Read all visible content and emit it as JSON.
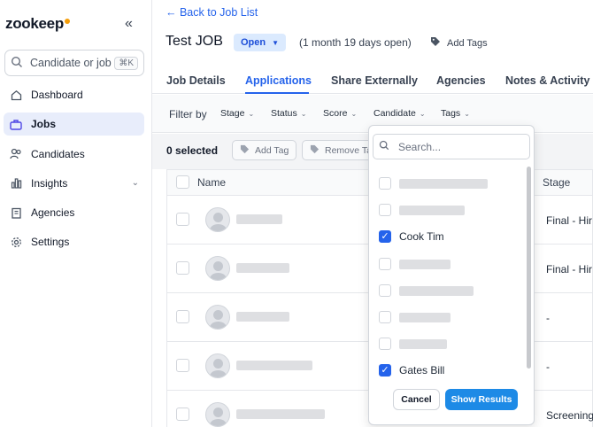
{
  "app": {
    "logo_text": "zookeep",
    "accent_color": "#2563eb",
    "brand_dot_color": "#f59e0b"
  },
  "sidebar": {
    "search_placeholder": "Candidate or job",
    "search_shortcut": "⌘K",
    "items": [
      {
        "label": "Dashboard",
        "icon": "home-icon",
        "active": false
      },
      {
        "label": "Jobs",
        "icon": "briefcase-icon",
        "active": true
      },
      {
        "label": "Candidates",
        "icon": "users-icon",
        "active": false
      },
      {
        "label": "Insights",
        "icon": "bar-chart-icon",
        "active": false,
        "has_chevron": true
      },
      {
        "label": "Agencies",
        "icon": "building-icon",
        "active": false
      },
      {
        "label": "Settings",
        "icon": "gear-icon",
        "active": false
      }
    ]
  },
  "header": {
    "back_label": "← Back to Job List",
    "job_title": "Test JOB",
    "status": "Open",
    "duration": "(1 month 19 days open)",
    "add_tags_label": "Add Tags"
  },
  "tabs": [
    {
      "label": "Job Details",
      "active": false
    },
    {
      "label": "Applications",
      "active": true
    },
    {
      "label": "Share Externally",
      "active": false
    },
    {
      "label": "Agencies",
      "active": false
    },
    {
      "label": "Notes & Activity",
      "active": false
    }
  ],
  "filters": {
    "label": "Filter by",
    "chips": [
      "Stage",
      "Status",
      "Score",
      "Candidate",
      "Tags"
    ]
  },
  "bulk": {
    "selected_text": "0 selected",
    "add_tag_label": "Add Tag",
    "remove_tag_label": "Remove Ta"
  },
  "table": {
    "columns": [
      "Name",
      "Stage"
    ],
    "rows": [
      {
        "stage": "Final - Hir"
      },
      {
        "stage": "Final - Hir"
      },
      {
        "stage": "-"
      },
      {
        "stage": "-"
      },
      {
        "stage": "Screening"
      }
    ]
  },
  "candidate_dropdown": {
    "search_placeholder": "Search...",
    "options": [
      {
        "name": "",
        "checked": false,
        "redacted": true
      },
      {
        "name": "",
        "checked": false,
        "redacted": true
      },
      {
        "name": "Cook Tim",
        "checked": true,
        "redacted": false
      },
      {
        "name": "",
        "checked": false,
        "redacted": true
      },
      {
        "name": "",
        "checked": false,
        "redacted": true
      },
      {
        "name": "",
        "checked": false,
        "redacted": true
      },
      {
        "name": "",
        "checked": false,
        "redacted": true
      },
      {
        "name": "Gates Bill",
        "checked": true,
        "redacted": false
      }
    ],
    "cancel_label": "Cancel",
    "show_results_label": "Show Results"
  }
}
